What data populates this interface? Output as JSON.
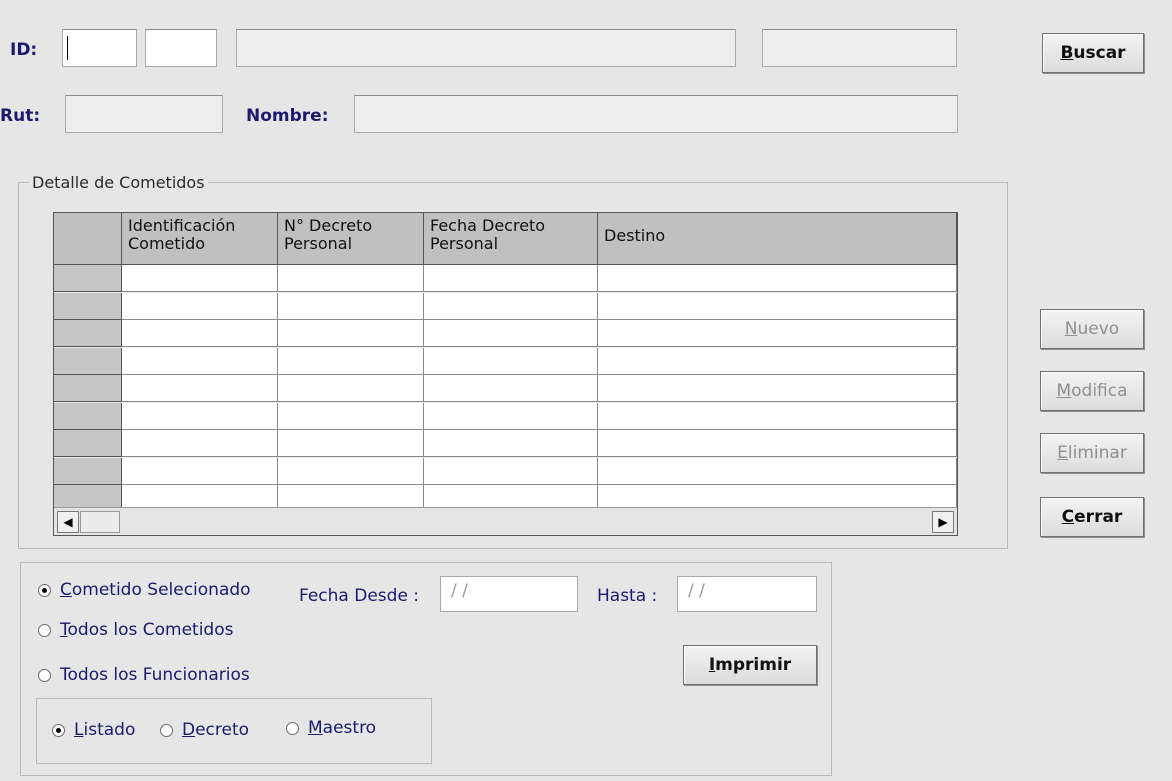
{
  "header": {
    "id_label": "ID:",
    "rut_label": "Rut:",
    "nombre_label": "Nombre:"
  },
  "buttons": {
    "buscar": {
      "underline": "B",
      "rest": "uscar"
    },
    "nuevo": {
      "underline": "N",
      "rest": "uevo"
    },
    "modifica": {
      "underline": "M",
      "rest": "odifica"
    },
    "eliminar": {
      "underline": "E",
      "rest": "liminar"
    },
    "cerrar": {
      "underline": "C",
      "rest": "errar"
    },
    "imprimir": {
      "underline": "I",
      "rest": "mprimir"
    }
  },
  "detalle": {
    "legend": "Detalle de Cometidos",
    "columns": [
      {
        "line1": "Identificación",
        "line2": "Cometido"
      },
      {
        "line1": "N° Decreto",
        "line2": "Personal"
      },
      {
        "line1": "Fecha Decreto",
        "line2": "Personal"
      },
      {
        "line1": "Destino",
        "line2": ""
      }
    ],
    "scroll_left": "◀",
    "scroll_right": "▶"
  },
  "options": {
    "cometido_selecionado": {
      "underline": "C",
      "rest": "ometido Selecionado",
      "checked": true
    },
    "todos_cometidos": {
      "underline": "T",
      "rest": "odos los  Cometidos",
      "checked": false
    },
    "todos_funcionarios": {
      "label": "Todos los Funcionarios",
      "checked": false
    },
    "fecha_desde_label": "Fecha Desde :",
    "fecha_desde_value": "/ /",
    "hasta_label": "Hasta :",
    "hasta_value": "/ /"
  },
  "format": {
    "listado": {
      "underline": "L",
      "rest": "istado",
      "checked": true
    },
    "decreto": {
      "underline": "D",
      "rest": "ecreto",
      "checked": false
    },
    "maestro": {
      "underline": "M",
      "rest": "aestro",
      "checked": false
    }
  }
}
